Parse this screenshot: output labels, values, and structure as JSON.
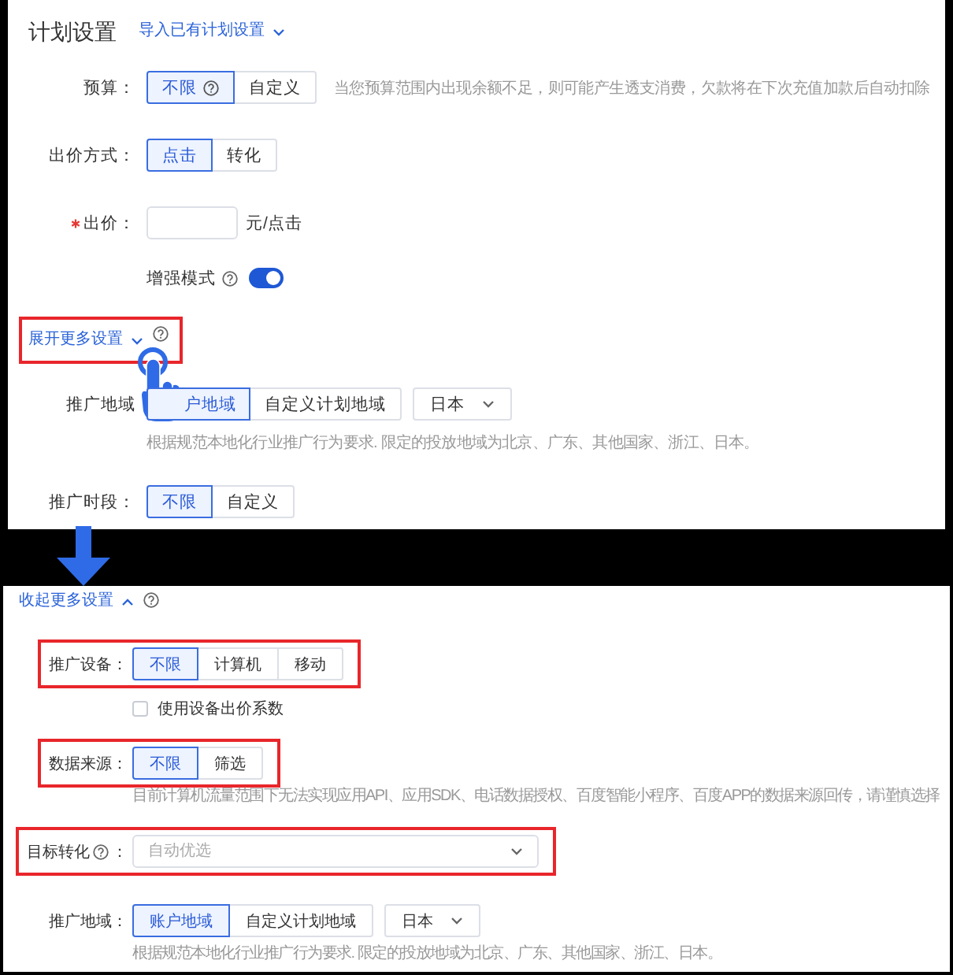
{
  "top_panel": {
    "title": "计划设置",
    "import_link": "导入已有计划设置",
    "rows": [
      {
        "kind": "segmented",
        "label": "预算：",
        "required": false,
        "help": false,
        "options": [
          {
            "label": "不限",
            "help": true,
            "selected": true
          },
          {
            "label": "自定义",
            "help": false,
            "selected": false
          }
        ],
        "hint": "当您预算范围内出现余额不足，则可能产生透支消费，欠款将在下次充值加款后自动扣除"
      },
      {
        "kind": "segmented",
        "label": "出价方式：",
        "required": false,
        "help": false,
        "options": [
          {
            "label": "点击",
            "help": false,
            "selected": true
          },
          {
            "label": "转化",
            "help": false,
            "selected": false
          }
        ]
      },
      {
        "kind": "input",
        "label": "出价：",
        "required": true,
        "help": false,
        "unit": "元/点击"
      },
      {
        "kind": "toggle",
        "text": "增强模式",
        "required": false,
        "help": true,
        "on": true
      }
    ],
    "more_link": {
      "label": "展开更多设置",
      "expanded": false,
      "help": true,
      "highlighted": true,
      "pointer": true
    },
    "more_rows": [
      {
        "kind": "segmented",
        "label": "推广地域",
        "required": false,
        "options": [
          {
            "label": "户地域",
            "help": false,
            "selected": true
          },
          {
            "label": "自定义计划地域",
            "help": false,
            "selected": false
          }
        ],
        "dropdown": "日本",
        "note": "根据规范本地化行业推广行为要求. 限定的投放地域为北京、广东、其他国家、浙江、日本。"
      },
      {
        "kind": "segmented",
        "label": "推广时段：",
        "required": false,
        "options": [
          {
            "label": "不限",
            "help": false,
            "selected": true
          },
          {
            "label": "自定义",
            "help": false,
            "selected": false
          }
        ]
      }
    ]
  },
  "arrow_between_panels": true,
  "bottom_panel": {
    "more_link": {
      "label": "收起更多设置",
      "expanded": true,
      "help": true,
      "highlighted": false,
      "pointer": false
    },
    "rows": [
      {
        "kind": "segmented",
        "label": "推广设备：",
        "help": false,
        "highlighted": true,
        "options": [
          {
            "label": "不限",
            "help": false,
            "selected": true
          },
          {
            "label": "计算机",
            "help": false,
            "selected": false
          },
          {
            "label": "移动",
            "help": false,
            "selected": false
          }
        ]
      },
      {
        "kind": "checkbox",
        "text": "使用设备出价系数",
        "help": false,
        "highlighted": false,
        "checked": false
      },
      {
        "kind": "segmented",
        "label": "数据来源：",
        "help": false,
        "highlighted": true,
        "options": [
          {
            "label": "不限",
            "help": false,
            "selected": true
          },
          {
            "label": "筛选",
            "help": false,
            "selected": false
          }
        ],
        "note": "目前计算机流量范围下无法实现应用API、应用SDK、电话数据授权、百度智能小程序、百度APP的数据来源回传，请谨慎选择"
      },
      {
        "kind": "select",
        "label": "目标转化",
        "help": true,
        "label_suffix": "：",
        "highlighted": true,
        "placeholder": "自动优选"
      },
      {
        "kind": "segmented",
        "label": "推广地域：",
        "help": false,
        "highlighted": false,
        "options": [
          {
            "label": "账户地域",
            "help": false,
            "selected": true
          },
          {
            "label": "自定义计划地域",
            "help": false,
            "selected": false
          }
        ],
        "dropdown": "日本",
        "note": "根据规范本地化行业推广行为要求. 限定的投放地域为北京、广东、其他国家、浙江、日本。"
      }
    ]
  }
}
